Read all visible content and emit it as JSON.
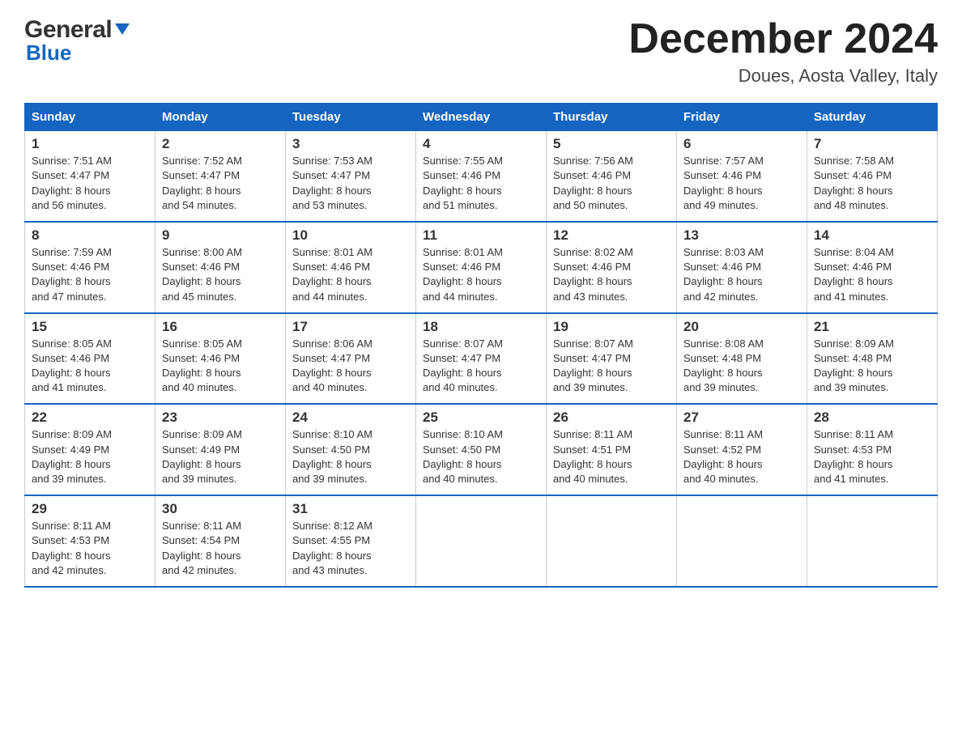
{
  "header": {
    "logo_line1": "General",
    "logo_line2": "Blue",
    "month_title": "December 2024",
    "location": "Doues, Aosta Valley, Italy"
  },
  "days_of_week": [
    "Sunday",
    "Monday",
    "Tuesday",
    "Wednesday",
    "Thursday",
    "Friday",
    "Saturday"
  ],
  "weeks": [
    [
      {
        "day": "1",
        "sunrise": "7:51 AM",
        "sunset": "4:47 PM",
        "daylight": "8 hours and 56 minutes."
      },
      {
        "day": "2",
        "sunrise": "7:52 AM",
        "sunset": "4:47 PM",
        "daylight": "8 hours and 54 minutes."
      },
      {
        "day": "3",
        "sunrise": "7:53 AM",
        "sunset": "4:47 PM",
        "daylight": "8 hours and 53 minutes."
      },
      {
        "day": "4",
        "sunrise": "7:55 AM",
        "sunset": "4:46 PM",
        "daylight": "8 hours and 51 minutes."
      },
      {
        "day": "5",
        "sunrise": "7:56 AM",
        "sunset": "4:46 PM",
        "daylight": "8 hours and 50 minutes."
      },
      {
        "day": "6",
        "sunrise": "7:57 AM",
        "sunset": "4:46 PM",
        "daylight": "8 hours and 49 minutes."
      },
      {
        "day": "7",
        "sunrise": "7:58 AM",
        "sunset": "4:46 PM",
        "daylight": "8 hours and 48 minutes."
      }
    ],
    [
      {
        "day": "8",
        "sunrise": "7:59 AM",
        "sunset": "4:46 PM",
        "daylight": "8 hours and 47 minutes."
      },
      {
        "day": "9",
        "sunrise": "8:00 AM",
        "sunset": "4:46 PM",
        "daylight": "8 hours and 45 minutes."
      },
      {
        "day": "10",
        "sunrise": "8:01 AM",
        "sunset": "4:46 PM",
        "daylight": "8 hours and 44 minutes."
      },
      {
        "day": "11",
        "sunrise": "8:01 AM",
        "sunset": "4:46 PM",
        "daylight": "8 hours and 44 minutes."
      },
      {
        "day": "12",
        "sunrise": "8:02 AM",
        "sunset": "4:46 PM",
        "daylight": "8 hours and 43 minutes."
      },
      {
        "day": "13",
        "sunrise": "8:03 AM",
        "sunset": "4:46 PM",
        "daylight": "8 hours and 42 minutes."
      },
      {
        "day": "14",
        "sunrise": "8:04 AM",
        "sunset": "4:46 PM",
        "daylight": "8 hours and 41 minutes."
      }
    ],
    [
      {
        "day": "15",
        "sunrise": "8:05 AM",
        "sunset": "4:46 PM",
        "daylight": "8 hours and 41 minutes."
      },
      {
        "day": "16",
        "sunrise": "8:05 AM",
        "sunset": "4:46 PM",
        "daylight": "8 hours and 40 minutes."
      },
      {
        "day": "17",
        "sunrise": "8:06 AM",
        "sunset": "4:47 PM",
        "daylight": "8 hours and 40 minutes."
      },
      {
        "day": "18",
        "sunrise": "8:07 AM",
        "sunset": "4:47 PM",
        "daylight": "8 hours and 40 minutes."
      },
      {
        "day": "19",
        "sunrise": "8:07 AM",
        "sunset": "4:47 PM",
        "daylight": "8 hours and 39 minutes."
      },
      {
        "day": "20",
        "sunrise": "8:08 AM",
        "sunset": "4:48 PM",
        "daylight": "8 hours and 39 minutes."
      },
      {
        "day": "21",
        "sunrise": "8:09 AM",
        "sunset": "4:48 PM",
        "daylight": "8 hours and 39 minutes."
      }
    ],
    [
      {
        "day": "22",
        "sunrise": "8:09 AM",
        "sunset": "4:49 PM",
        "daylight": "8 hours and 39 minutes."
      },
      {
        "day": "23",
        "sunrise": "8:09 AM",
        "sunset": "4:49 PM",
        "daylight": "8 hours and 39 minutes."
      },
      {
        "day": "24",
        "sunrise": "8:10 AM",
        "sunset": "4:50 PM",
        "daylight": "8 hours and 39 minutes."
      },
      {
        "day": "25",
        "sunrise": "8:10 AM",
        "sunset": "4:50 PM",
        "daylight": "8 hours and 40 minutes."
      },
      {
        "day": "26",
        "sunrise": "8:11 AM",
        "sunset": "4:51 PM",
        "daylight": "8 hours and 40 minutes."
      },
      {
        "day": "27",
        "sunrise": "8:11 AM",
        "sunset": "4:52 PM",
        "daylight": "8 hours and 40 minutes."
      },
      {
        "day": "28",
        "sunrise": "8:11 AM",
        "sunset": "4:53 PM",
        "daylight": "8 hours and 41 minutes."
      }
    ],
    [
      {
        "day": "29",
        "sunrise": "8:11 AM",
        "sunset": "4:53 PM",
        "daylight": "8 hours and 42 minutes."
      },
      {
        "day": "30",
        "sunrise": "8:11 AM",
        "sunset": "4:54 PM",
        "daylight": "8 hours and 42 minutes."
      },
      {
        "day": "31",
        "sunrise": "8:12 AM",
        "sunset": "4:55 PM",
        "daylight": "8 hours and 43 minutes."
      },
      null,
      null,
      null,
      null
    ]
  ],
  "labels": {
    "sunrise": "Sunrise:",
    "sunset": "Sunset:",
    "daylight": "Daylight:"
  },
  "accent_color": "#1565c0"
}
